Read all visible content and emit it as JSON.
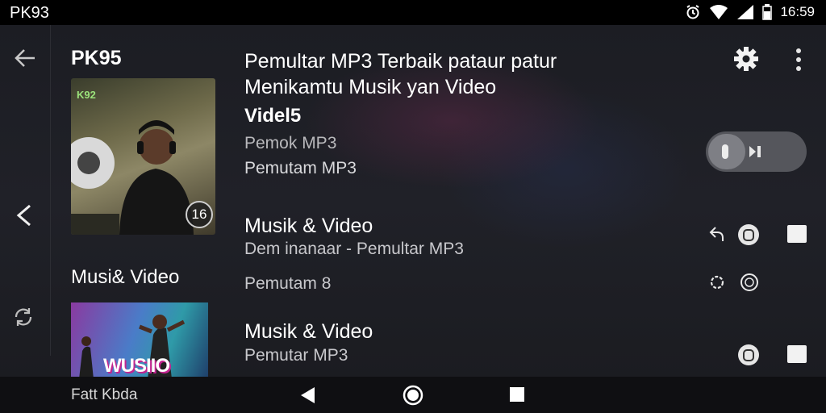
{
  "status_bar": {
    "title": "PK93",
    "time": "16:59",
    "icons": [
      "alarm-icon",
      "wifi-icon",
      "signal-icon",
      "battery-icon"
    ]
  },
  "album": {
    "title": "PK95",
    "art_logo": "K92",
    "badge": "16"
  },
  "section": {
    "title": "Musi& Video",
    "art_text": "WUSIIO"
  },
  "header": {
    "headline_line1": "Pemultar MP3 Terbaik pataur patur",
    "headline_line2": "Menikamtu Musik yan Video",
    "subhead": "Videl5",
    "meta1": "Pemok MP3",
    "meta2": "Pemutam MP3"
  },
  "rows": [
    {
      "title": "Musik & Video",
      "subtitle": "Dem inanaar - Pemultar MP3"
    },
    {
      "title": "",
      "subtitle": "Pemutam 8"
    },
    {
      "title": "Musik & Video",
      "subtitle": "Pemutar MP3"
    }
  ],
  "nav": {
    "label": "Fatt Kbda"
  },
  "colors": {
    "background": "#1a1b20",
    "status_bar": "#000000",
    "toggle_track": "#55565c",
    "accent_text": "#ffffff"
  }
}
